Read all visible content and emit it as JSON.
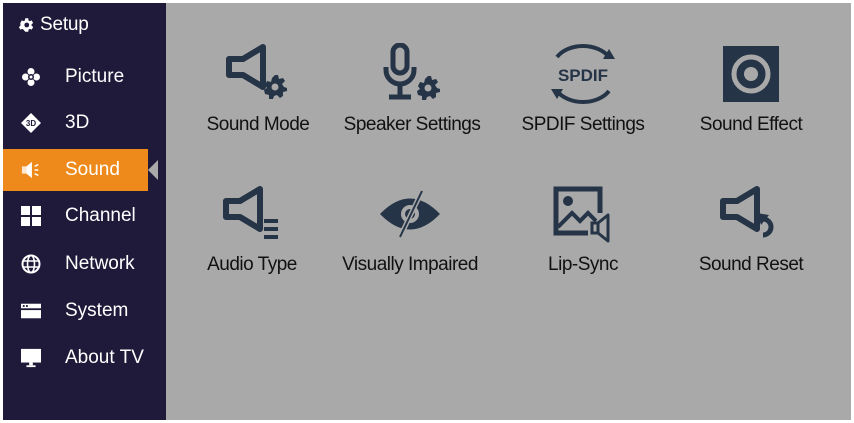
{
  "colors": {
    "sidebar_bg": "#1f1a39",
    "content_bg": "#a9a9a9",
    "accent": "#ee8a1c",
    "icon_color": "#253446"
  },
  "sidebar": {
    "header": {
      "label": "Setup",
      "icon": "gear-icon"
    },
    "items": [
      {
        "label": "Picture",
        "icon": "picture-icon",
        "active": false
      },
      {
        "label": "3D",
        "icon": "3d-icon",
        "active": false
      },
      {
        "label": "Sound",
        "icon": "sound-icon",
        "active": true
      },
      {
        "label": "Channel",
        "icon": "channel-grid-icon",
        "active": false
      },
      {
        "label": "Network",
        "icon": "globe-icon",
        "active": false
      },
      {
        "label": "System",
        "icon": "system-icon",
        "active": false
      },
      {
        "label": "About TV",
        "icon": "monitor-icon",
        "active": false
      }
    ]
  },
  "tiles": [
    {
      "label": "Sound Mode",
      "icon": "speaker-gear-icon"
    },
    {
      "label": "Speaker Settings",
      "icon": "microphone-gear-icon"
    },
    {
      "label": "SPDIF Settings",
      "icon": "spdif-icon"
    },
    {
      "label": "Sound Effect",
      "icon": "sound-effect-icon"
    },
    {
      "label": "Audio Type",
      "icon": "speaker-lines-icon"
    },
    {
      "label": "Visually Impaired",
      "icon": "eye-slash-icon"
    },
    {
      "label": "Lip-Sync",
      "icon": "image-speaker-icon"
    },
    {
      "label": "Sound Reset",
      "icon": "speaker-reset-icon"
    }
  ],
  "icon_text": {
    "spdif": "SPDIF",
    "three_d": "3D"
  }
}
